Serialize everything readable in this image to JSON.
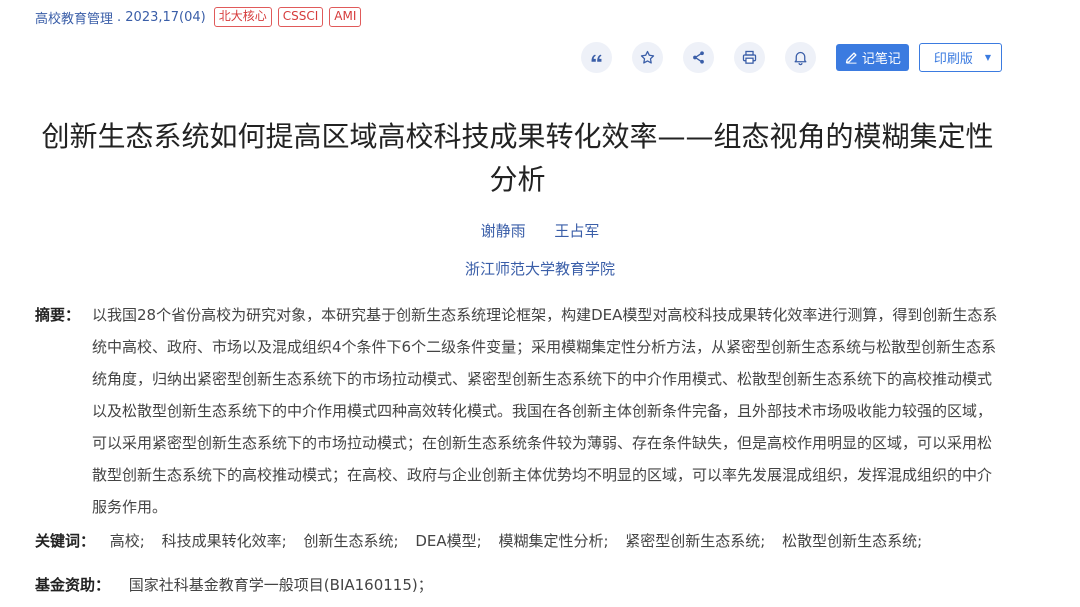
{
  "journal": {
    "name": "高校教育管理",
    "date": ". 2023,17(04)",
    "tags": [
      "北大核心",
      "CSSCI",
      "AMI"
    ]
  },
  "toolbar": {
    "icons": [
      "quote-icon",
      "star-icon",
      "share-icon",
      "print-icon",
      "bell-icon"
    ],
    "note_label": "记笔记",
    "print_label": "印刷版"
  },
  "article": {
    "title": "创新生态系统如何提高区域高校科技成果转化效率——组态视角的模糊集定性分析",
    "authors": [
      "谢静雨",
      "王占军"
    ],
    "affiliation": "浙江师范大学教育学院"
  },
  "abstract": {
    "label": "摘要：",
    "text": "以我国28个省份高校为研究对象，本研究基于创新生态系统理论框架，构建DEA模型对高校科技成果转化效率进行测算，得到创新生态系统中高校、政府、市场以及混成组织4个条件下6个二级条件变量；采用模糊集定性分析方法，从紧密型创新生态系统与松散型创新生态系统角度，归纳出紧密型创新生态系统下的市场拉动模式、紧密型创新生态系统下的中介作用模式、松散型创新生态系统下的高校推动模式以及松散型创新生态系统下的中介作用模式四种高效转化模式。我国在各创新主体创新条件完备，且外部技术市场吸收能力较强的区域，可以采用紧密型创新生态系统下的市场拉动模式；在创新生态系统条件较为薄弱、存在条件缺失，但是高校作用明显的区域，可以采用松散型创新生态系统下的高校推动模式；在高校、政府与企业创新主体优势均不明显的区域，可以率先发展混成组织，发挥混成组织的中介服务作用。"
  },
  "keywords": {
    "label": "关键词：",
    "items": [
      "高校;",
      "科技成果转化效率;",
      "创新生态系统;",
      "DEA模型;",
      "模糊集定性分析;",
      "紧密型创新生态系统;",
      "松散型创新生态系统;"
    ]
  },
  "fund": {
    "label": "基金资助：",
    "value": "国家社科基金教育学一般项目(BIA160115)；"
  },
  "colors": {
    "link": "#3a5ea8",
    "tag": "#d63b3b",
    "primary_button": "#3b7be0",
    "icon_circle": "#eef1f8"
  }
}
